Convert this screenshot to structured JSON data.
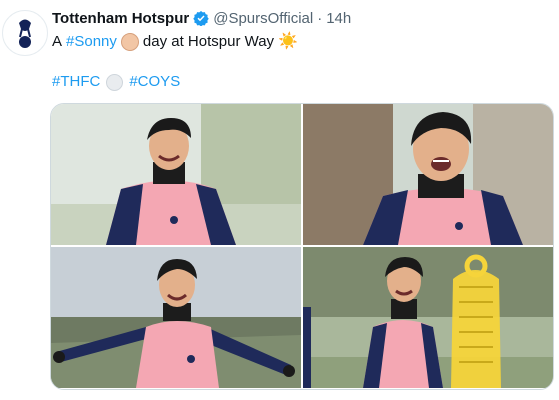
{
  "tweet": {
    "author_name": "Tottenham Hotspur",
    "handle": "@SpursOfficial",
    "separator": "·",
    "time": "14h",
    "text": {
      "prefix": "A",
      "hashtag": "#Sonny",
      "face_emoji": "player-face-emoji",
      "suffix": "day at Hotspur Way",
      "trailing_emoji": "☀️"
    },
    "tags": [
      "#THFC",
      "#COYS"
    ],
    "tag_emoji": "football-emoji"
  },
  "colors": {
    "link": "#1d9bf0",
    "verified": "#1d9bf0",
    "muted": "#536471",
    "kit_pink": "#f4a7b3",
    "kit_navy": "#1f2a5a"
  },
  "media": {
    "photos": [
      {
        "description_icon": "player-smiling-photo"
      },
      {
        "description_icon": "player-laughing-photo"
      },
      {
        "description_icon": "player-arms-out-photo"
      },
      {
        "description_icon": "player-training-dummy-photo"
      }
    ]
  }
}
